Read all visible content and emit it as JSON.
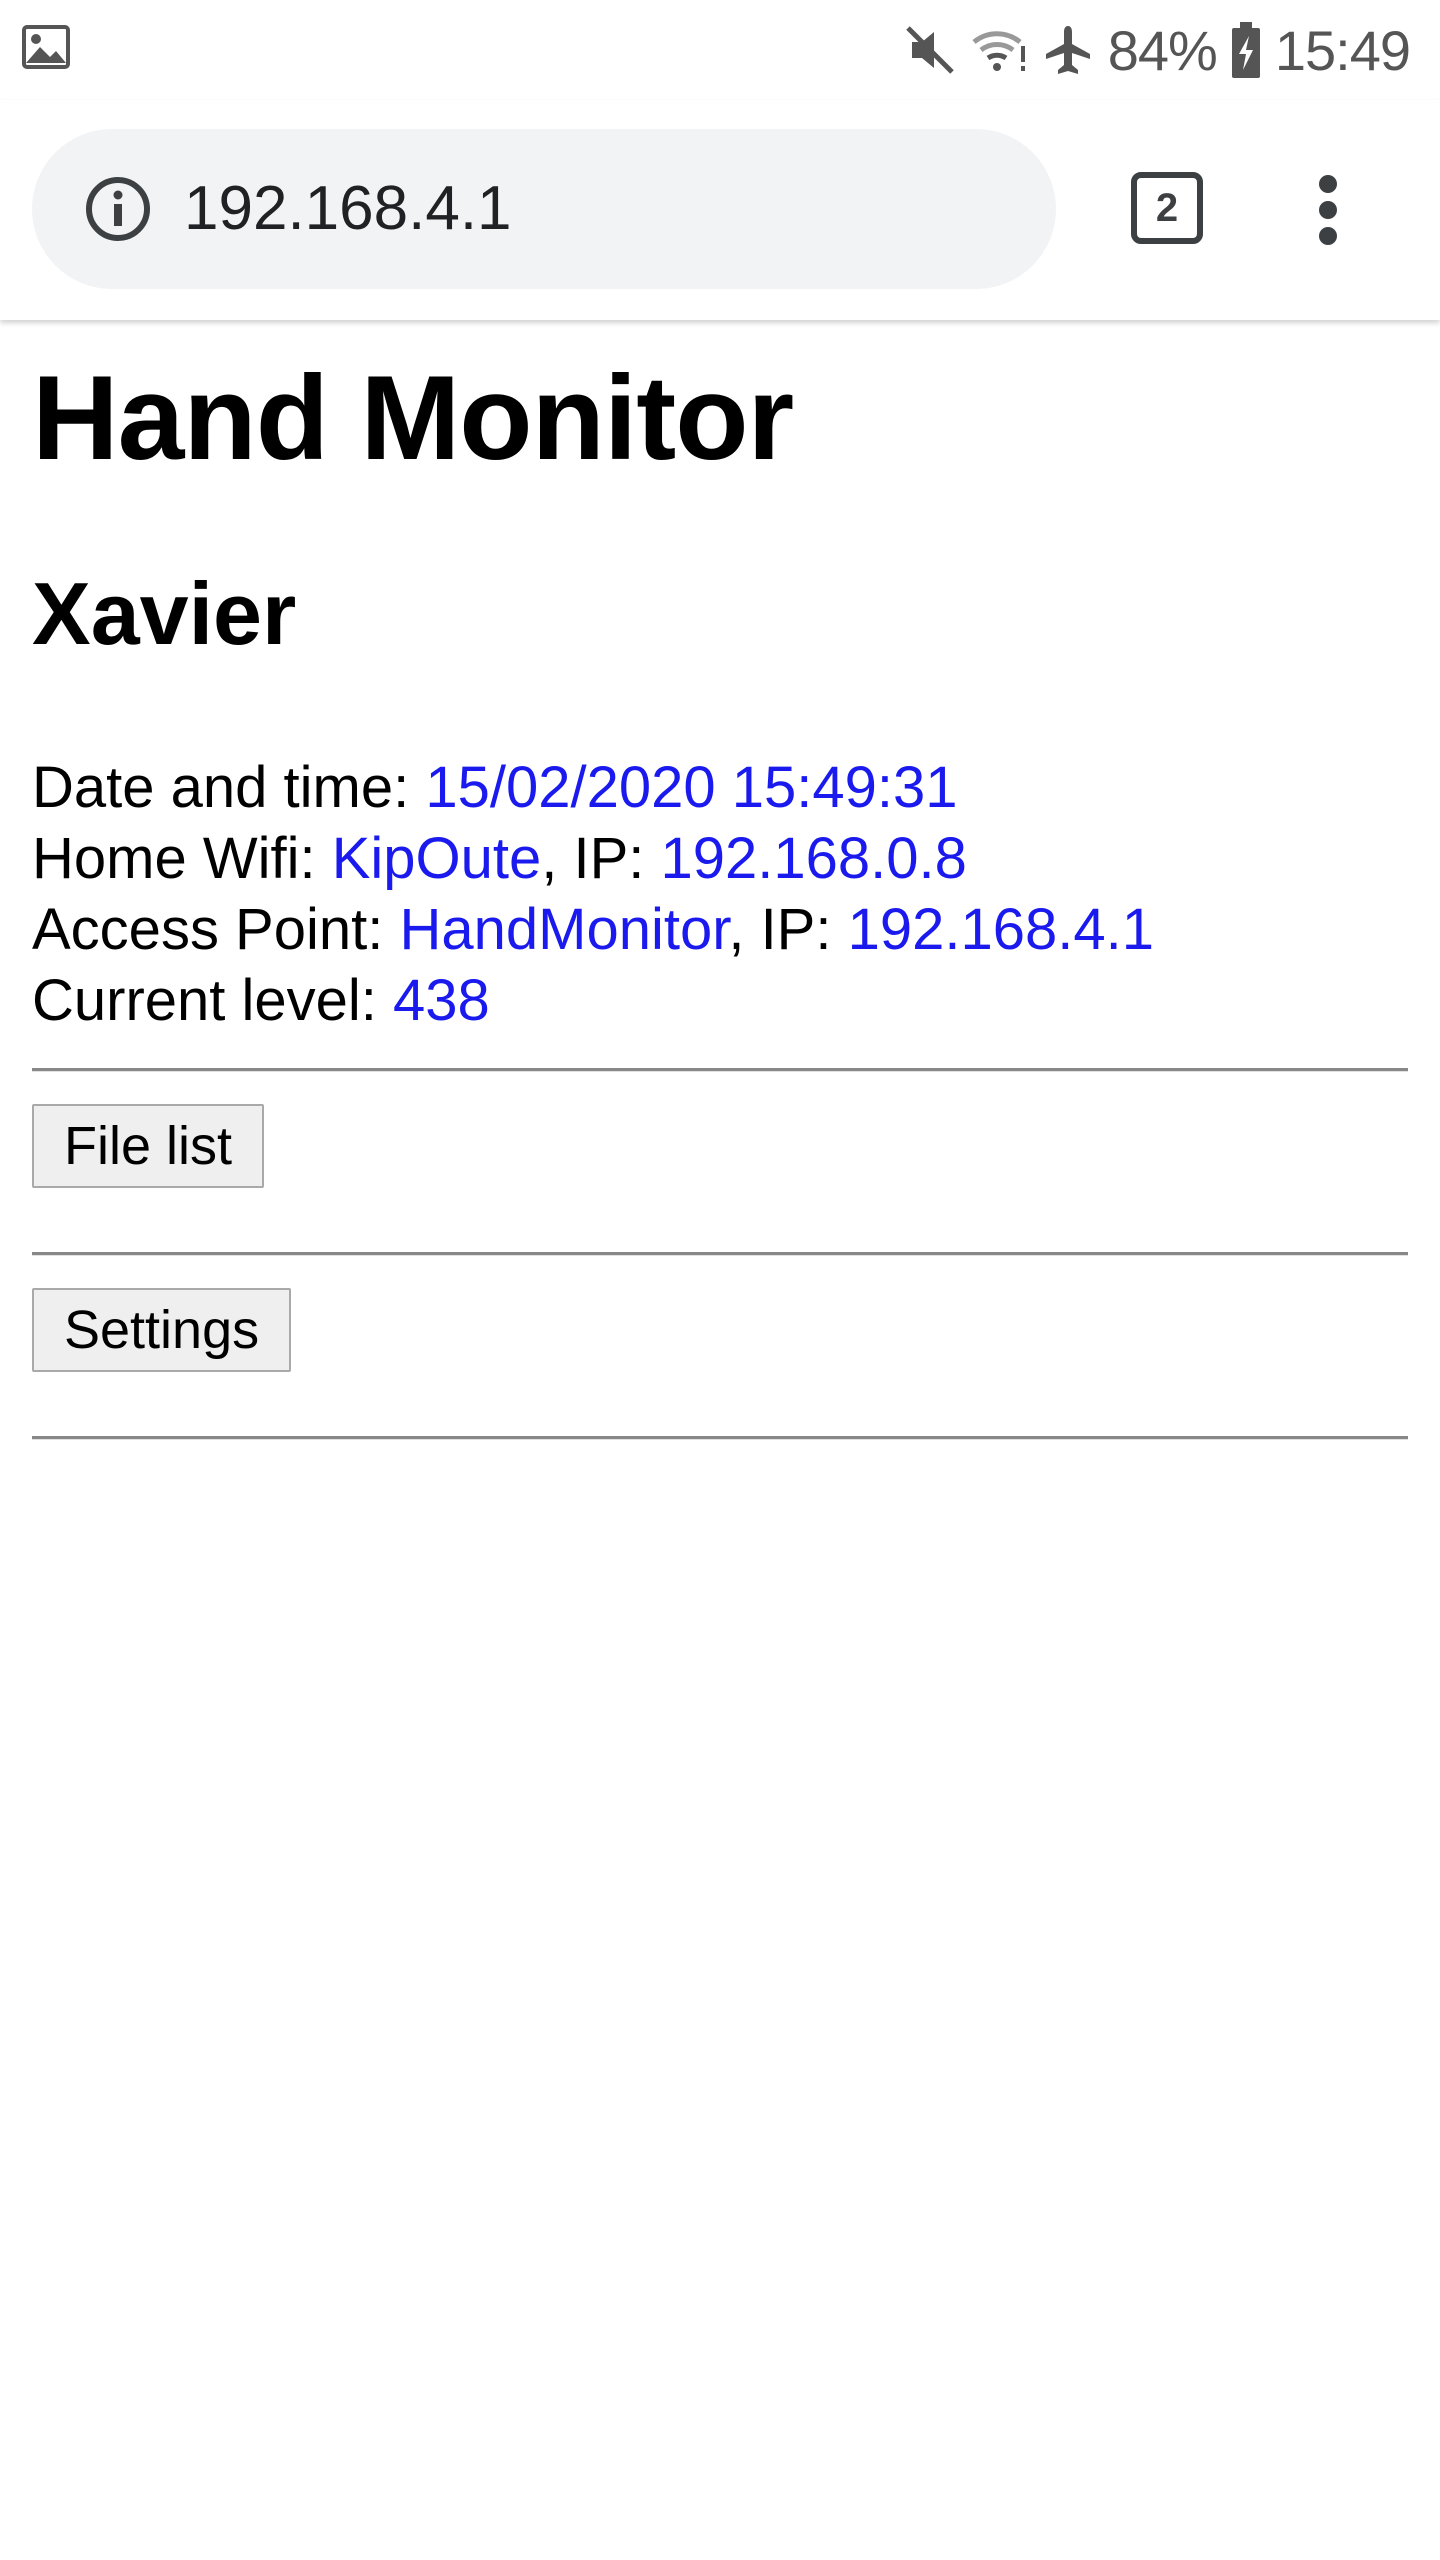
{
  "status_bar": {
    "battery": "84%",
    "time": "15:49",
    "icons": [
      "gallery-icon",
      "mute-icon",
      "wifi-icon",
      "airplane-icon",
      "battery-charging-icon"
    ]
  },
  "browser": {
    "url": "192.168.4.1",
    "tab_count": "2"
  },
  "page": {
    "title": "Hand Monitor",
    "device_name": "Xavier",
    "date_label": "Date and time: ",
    "date_value": "15/02/2020 15:49:31",
    "wifi_label": "Home Wifi: ",
    "wifi_ssid": "KipOute",
    "wifi_ip_label": ", IP: ",
    "wifi_ip": "192.168.0.8",
    "ap_label": "Access Point: ",
    "ap_ssid": "HandMonitor",
    "ap_ip_label": ", IP: ",
    "ap_ip": "192.168.4.1",
    "level_label": "Current level: ",
    "level_value": "438",
    "file_list_button": "File list",
    "settings_button": "Settings"
  },
  "colors": {
    "value_text": "#1a1aee",
    "omnibox_bg": "#f1f3f4"
  }
}
